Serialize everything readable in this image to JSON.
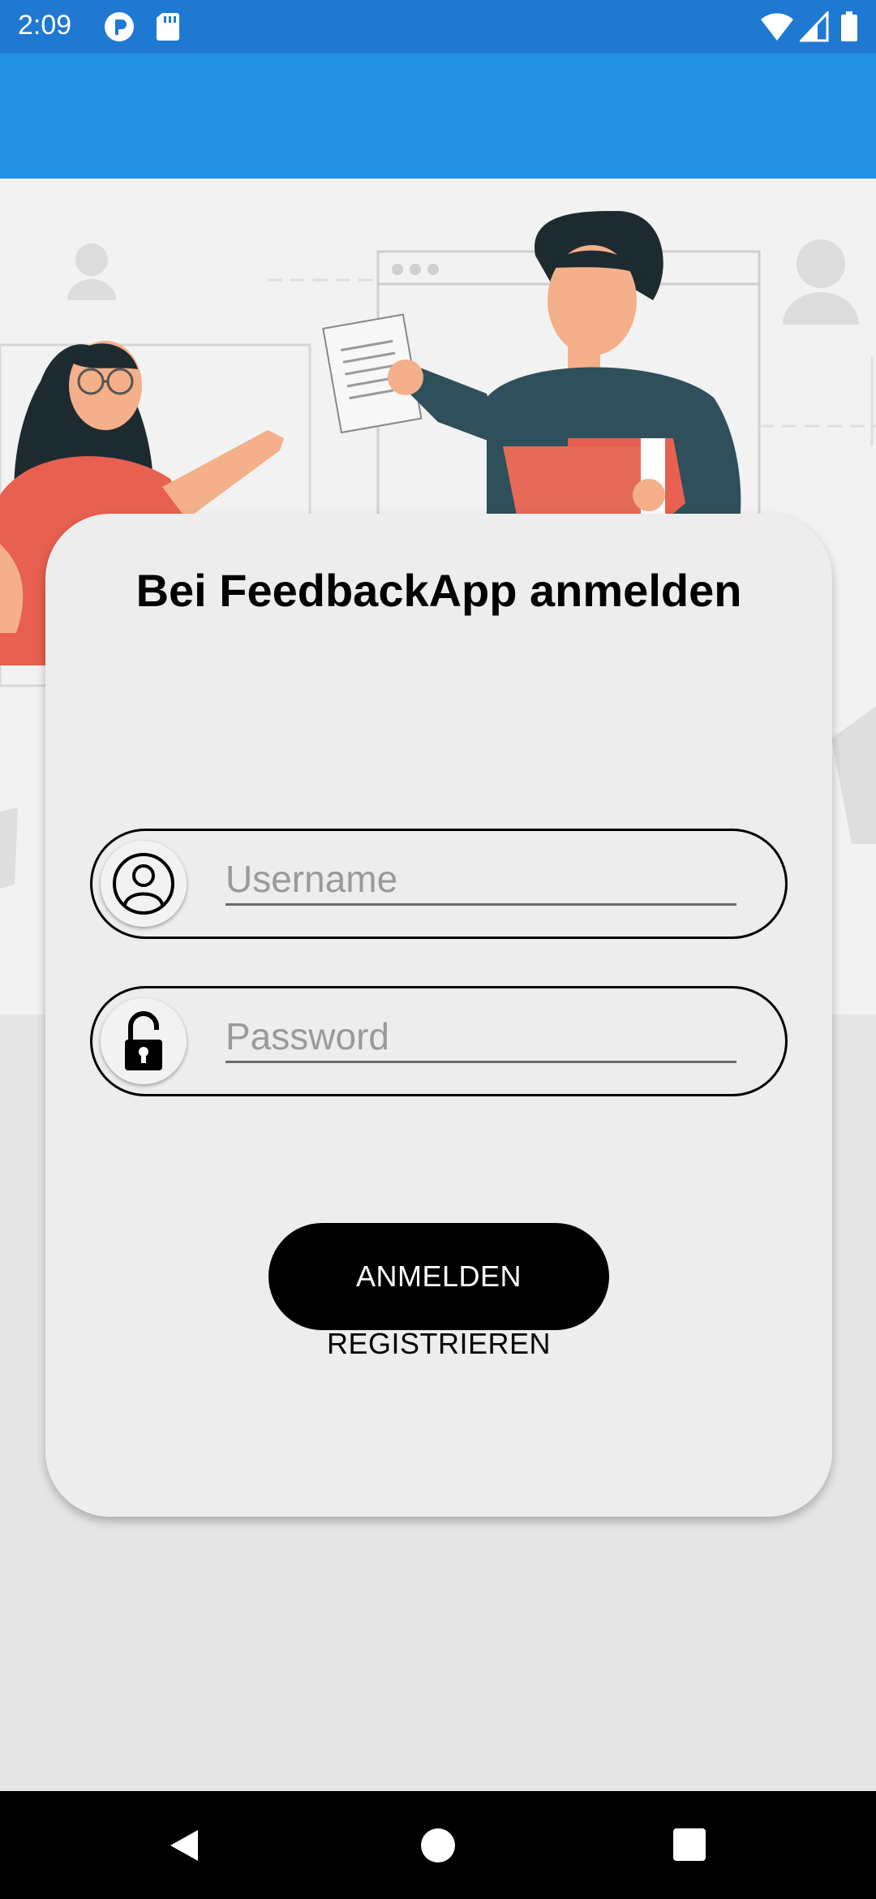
{
  "status_bar": {
    "time": "2:09",
    "icons": [
      "notification-app-icon",
      "sd-card-icon",
      "wifi-icon",
      "signal-icon",
      "battery-icon"
    ]
  },
  "hero": {
    "illustration": "two-people-sharing-documents-illustration"
  },
  "login_card": {
    "title": "Bei FeedbackApp anmelden",
    "username": {
      "icon": "user-circle-icon",
      "placeholder": "Username",
      "value": ""
    },
    "password": {
      "icon": "unlocked-padlock-icon",
      "placeholder": "Password",
      "value": ""
    },
    "login_label": "ANMELDEN",
    "register_label": "REGISTRIEREN"
  },
  "nav_bar": {
    "items": [
      "back-triangle-icon",
      "home-circle-icon",
      "recents-square-icon"
    ]
  },
  "colors": {
    "status_bar": "#1f78d1",
    "app_bar": "#2391e3",
    "card_bg": "#ededed",
    "button_bg": "#000000",
    "accent_red": "#e8604f",
    "shirt_teal": "#2f4f5a"
  }
}
